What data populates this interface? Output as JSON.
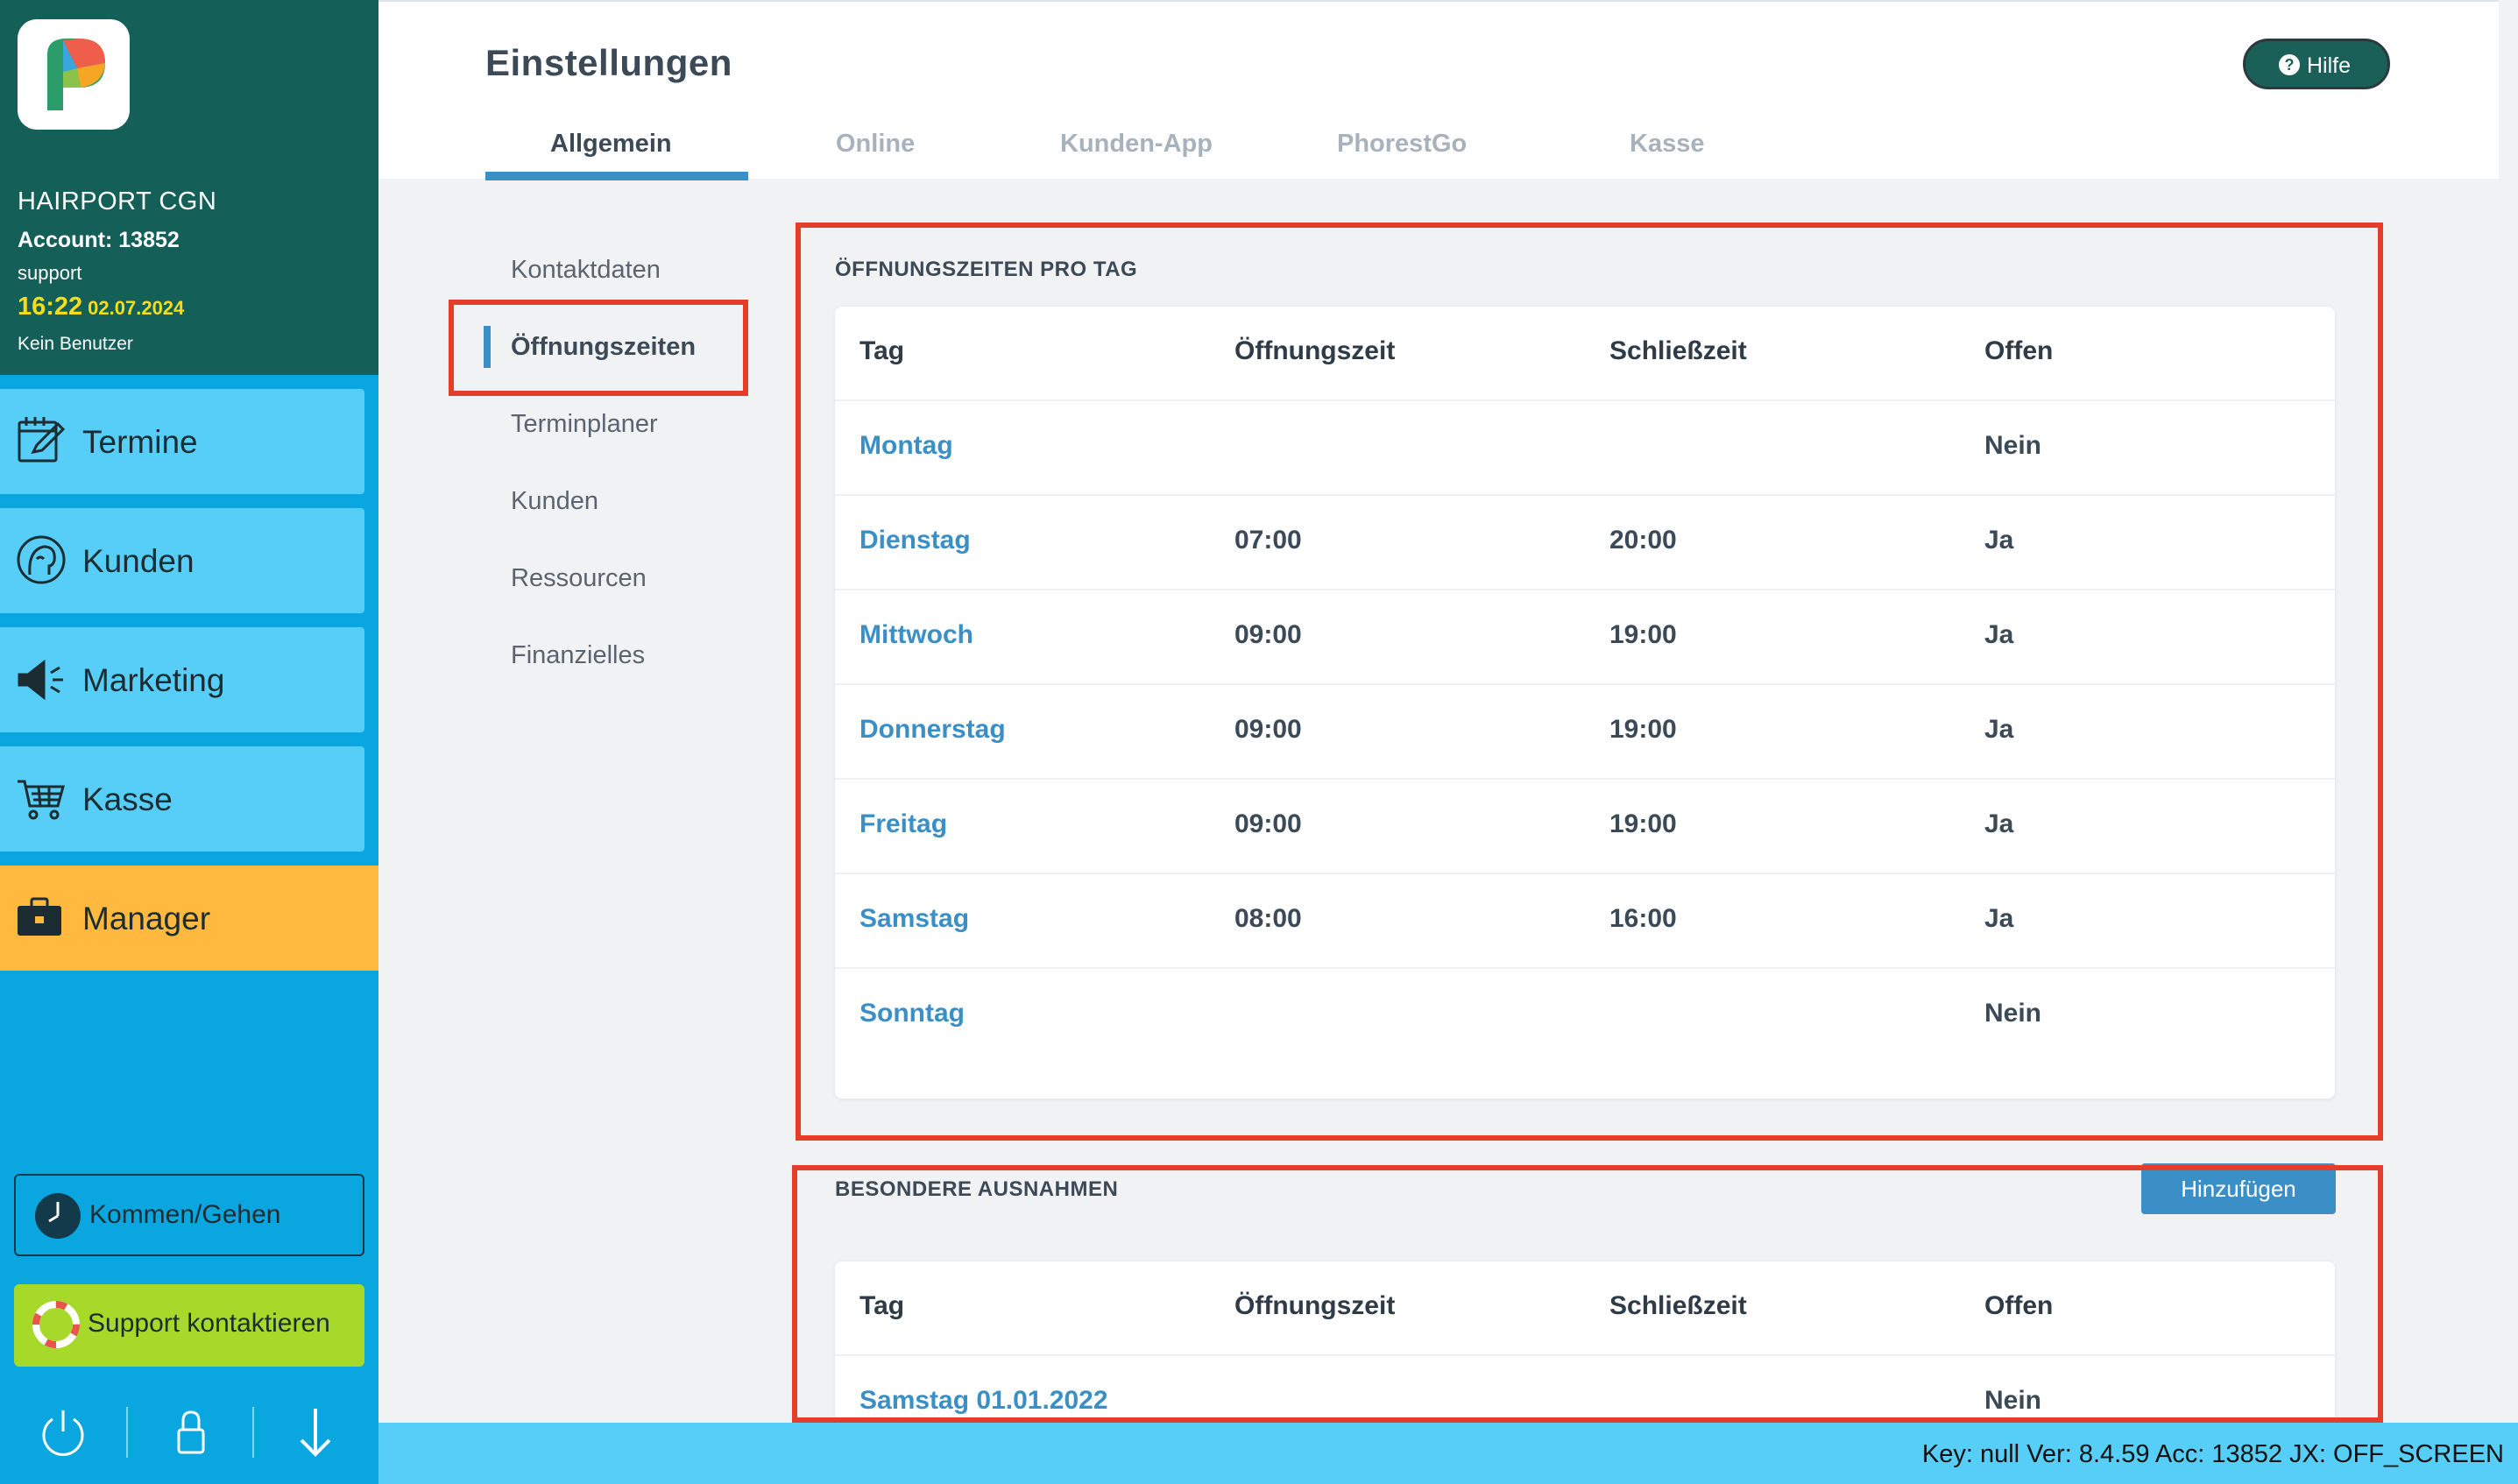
{
  "account": {
    "salon_name": "HAIRPORT CGN",
    "account_label": "Account: 13852",
    "user": "support",
    "time": "16:22",
    "date": "02.07.2024",
    "active_user": "Kein Benutzer"
  },
  "sidebar": {
    "items": [
      {
        "label": "Termine",
        "icon": "calendar-edit-icon"
      },
      {
        "label": "Kunden",
        "icon": "customer-head-icon"
      },
      {
        "label": "Marketing",
        "icon": "megaphone-icon"
      },
      {
        "label": "Kasse",
        "icon": "shopping-cart-icon"
      },
      {
        "label": "Manager",
        "icon": "briefcase-icon"
      }
    ],
    "clock_label": "Kommen/Gehen",
    "support_label": "Support kontaktieren",
    "footer_icons": [
      "power-icon",
      "lock-icon",
      "arrow-down-icon"
    ]
  },
  "header": {
    "title": "Einstellungen",
    "help_label": "Hilfe",
    "tabs": [
      {
        "label": "Allgemein",
        "active": true
      },
      {
        "label": "Online",
        "active": false
      },
      {
        "label": "Kunden-App",
        "active": false
      },
      {
        "label": "PhorestGo",
        "active": false
      },
      {
        "label": "Kasse",
        "active": false
      }
    ]
  },
  "subnav": {
    "items": [
      {
        "label": "Kontaktdaten",
        "active": false
      },
      {
        "label": "Öffnungszeiten",
        "active": true
      },
      {
        "label": "Terminplaner",
        "active": false
      },
      {
        "label": "Kunden",
        "active": false
      },
      {
        "label": "Ressourcen",
        "active": false
      },
      {
        "label": "Finanzielles",
        "active": false
      }
    ]
  },
  "hours": {
    "title": "ÖFFNUNGSZEITEN PRO TAG",
    "columns": [
      "Tag",
      "Öffnungszeit",
      "Schließzeit",
      "Offen"
    ],
    "rows": [
      {
        "day": "Montag",
        "open": "",
        "close": "",
        "is_open": "Nein"
      },
      {
        "day": "Dienstag",
        "open": "07:00",
        "close": "20:00",
        "is_open": "Ja"
      },
      {
        "day": "Mittwoch",
        "open": "09:00",
        "close": "19:00",
        "is_open": "Ja"
      },
      {
        "day": "Donnerstag",
        "open": "09:00",
        "close": "19:00",
        "is_open": "Ja"
      },
      {
        "day": "Freitag",
        "open": "09:00",
        "close": "19:00",
        "is_open": "Ja"
      },
      {
        "day": "Samstag",
        "open": "08:00",
        "close": "16:00",
        "is_open": "Ja"
      },
      {
        "day": "Sonntag",
        "open": "",
        "close": "",
        "is_open": "Nein"
      }
    ]
  },
  "exceptions": {
    "title": "BESONDERE AUSNAHMEN",
    "add_label": "Hinzufügen",
    "columns": [
      "Tag",
      "Öffnungszeit",
      "Schließzeit",
      "Offen"
    ],
    "rows": [
      {
        "day": "Samstag 01.01.2022",
        "open": "",
        "close": "",
        "is_open": "Nein"
      }
    ]
  },
  "status_bar": "Key: null Ver: 8.4.59 Acc: 13852  JX: OFF_SCREEN",
  "colors": {
    "brand_dark": "#145f58",
    "sidebar_blue": "#0aa6e0",
    "nav_tile": "#56cef8",
    "manager_active": "#ffb93f",
    "support_green": "#a6d92a",
    "accent_blue": "#3b8fc7",
    "highlight_red": "#e43d2a",
    "time_yellow": "#f5de19"
  }
}
